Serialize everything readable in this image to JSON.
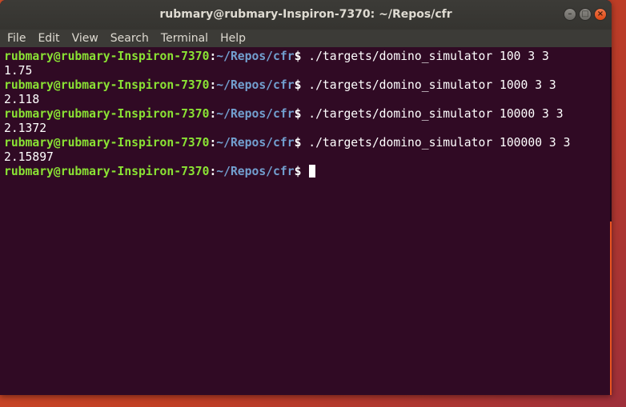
{
  "window": {
    "title": "rubmary@rubmary-Inspiron-7370: ~/Repos/cfr",
    "buttons": [
      "minimize-icon",
      "maximize-icon",
      "close-icon"
    ]
  },
  "menu": [
    "File",
    "Edit",
    "View",
    "Search",
    "Terminal",
    "Help"
  ],
  "prompt": {
    "user_host": "rubmary@rubmary-Inspiron-7370",
    "colon": ":",
    "path": "~/Repos/cfr",
    "dollar": "$"
  },
  "session": [
    {
      "command": " ./targets/domino_simulator 100 3 3",
      "output": "1.75"
    },
    {
      "command": " ./targets/domino_simulator 1000 3 3",
      "output": "2.118"
    },
    {
      "command": " ./targets/domino_simulator 10000 3 3",
      "output": "2.1372"
    },
    {
      "command": " ./targets/domino_simulator 100000 3 3",
      "output": "2.15897"
    }
  ],
  "colors": {
    "background": "#300a24",
    "prompt_user": "#8ae234",
    "prompt_path": "#729fcf",
    "text": "#ffffff",
    "titlebar": "#3c3b37",
    "accent": "#e95420"
  }
}
